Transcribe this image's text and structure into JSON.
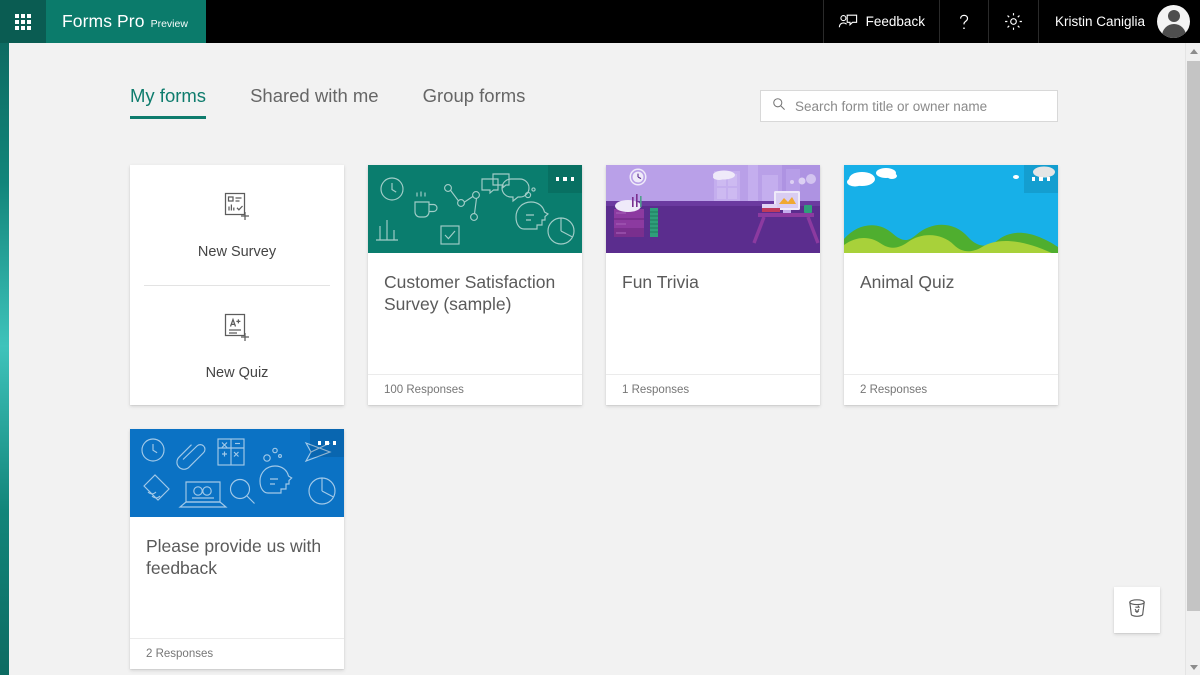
{
  "suite_bar": {
    "waffle_icon": "app-launcher-waffle-icon",
    "brand_title": "Forms Pro",
    "brand_preview": "Preview",
    "feedback_label": "Feedback",
    "feedback_icon": "feedback-person-comment-icon",
    "help_icon": "question-mark-icon",
    "settings_icon": "gear-icon",
    "user_name": "Kristin Caniglia",
    "avatar_icon": "user-avatar-icon"
  },
  "tabs": [
    {
      "label": "My forms",
      "active": true
    },
    {
      "label": "Shared with me",
      "active": false
    },
    {
      "label": "Group forms",
      "active": false
    }
  ],
  "search": {
    "placeholder": "Search form title or owner name",
    "value": "",
    "icon": "search-icon"
  },
  "new_card": {
    "survey_label": "New Survey",
    "survey_icon": "new-survey-document-icon",
    "quiz_label": "New Quiz",
    "quiz_icon": "new-quiz-a-plus-icon"
  },
  "cards": [
    {
      "title": "Customer Satisfaction Survey (sample)",
      "responses": "100 Responses",
      "banner_style": "teal-icons",
      "banner_color": "#0a7d6e",
      "menu_icon": "more-options-icon"
    },
    {
      "title": "Fun Trivia",
      "responses": "1 Responses",
      "banner_style": "purple-office",
      "banner_color": "#b9a0e8",
      "menu_icon": "more-options-icon"
    },
    {
      "title": "Animal Quiz",
      "responses": "2 Responses",
      "banner_style": "sky-hills",
      "banner_color": "#17b0e8",
      "menu_icon": "more-options-icon"
    },
    {
      "title": "Please provide us with feedback",
      "responses": "2 Responses",
      "banner_style": "blue-icons",
      "banner_color": "#0b72c4",
      "menu_icon": "more-options-icon"
    }
  ],
  "recycle_bin": {
    "icon": "recycle-bin-icon"
  },
  "scrollbar": {
    "up_icon": "scroll-up-arrow-icon",
    "down_icon": "scroll-down-arrow-icon"
  },
  "colors": {
    "brand_teal": "#0b7b6b",
    "waffle_teal": "#0a5c52",
    "accent_teal": "#0e7c6d",
    "page_bg": "#f2f2f2",
    "suite_black": "#000000"
  }
}
